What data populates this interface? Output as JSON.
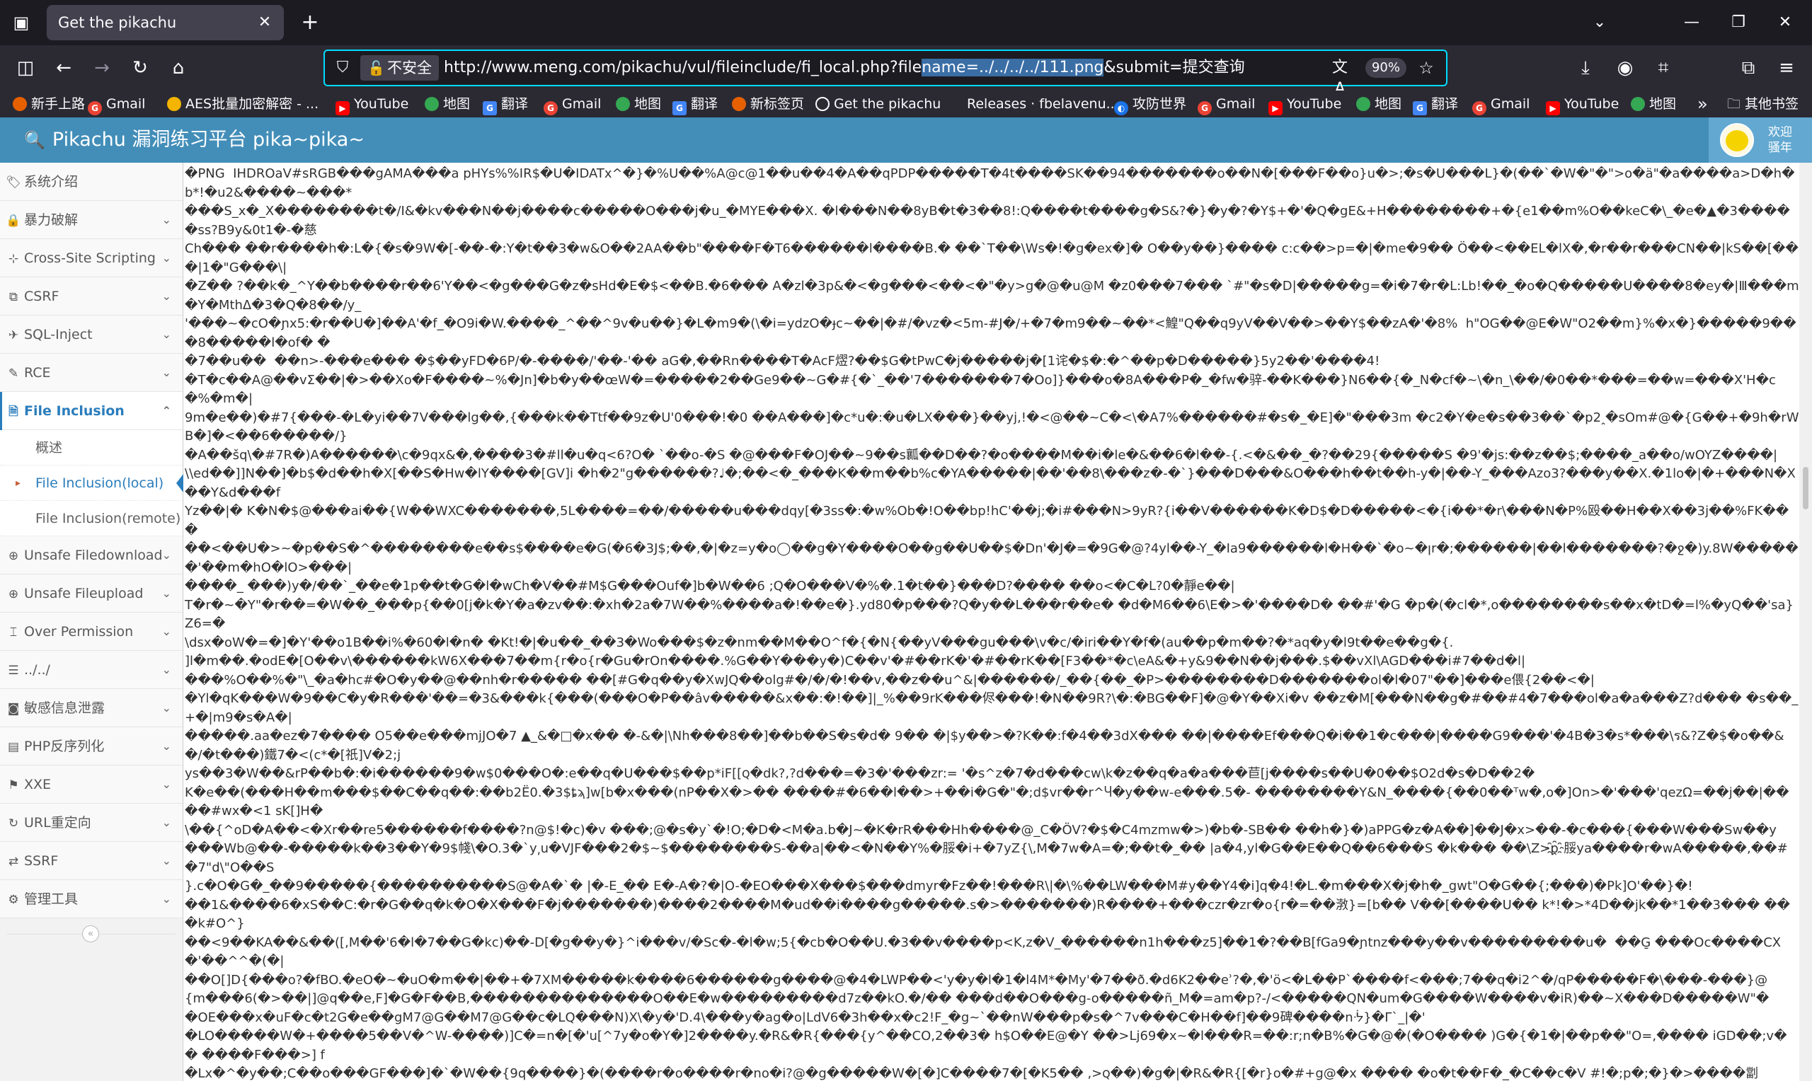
{
  "browser": {
    "tab_title": "Get the pikachu",
    "url_prefix": "http://www.meng.com/pikachu/vul/fileinclude/fi_local.php?file",
    "url_selected": "name=../../../../111.png",
    "url_suffix": "&submit=提交查询",
    "security_label": "不安全",
    "zoom": "90%",
    "icons": {
      "tab_overview": "tab-overview-icon",
      "close": "close-icon",
      "new_tab": "plus-icon",
      "back": "back-arrow-icon",
      "forward": "forward-arrow-icon",
      "reload": "reload-icon",
      "home": "home-icon",
      "sidebar_toggle": "sidebar-toggle-icon",
      "shield": "shield-icon",
      "lock": "insecure-lock-icon",
      "translate": "translate-icon",
      "star": "star-icon",
      "download": "download-icon",
      "account": "account-icon",
      "extensions": "extensions-icon",
      "menu": "hamburger-menu-icon"
    }
  },
  "bookmarks": [
    {
      "label": "新手上路",
      "color": "#e66000"
    },
    {
      "label": "Gmail",
      "color": "#ea4335"
    },
    {
      "label": "AES批量加密解密 - ...",
      "color": "#f4b400"
    },
    {
      "label": "YouTube",
      "color": "#ff0000"
    },
    {
      "label": "地图",
      "color": "#34a853"
    },
    {
      "label": "翻译",
      "color": "#4285f4"
    },
    {
      "label": "Gmail",
      "color": "#ea4335"
    },
    {
      "label": "地图",
      "color": "#34a853"
    },
    {
      "label": "翻译",
      "color": "#4285f4"
    },
    {
      "label": "新标签页",
      "color": "#e66000"
    },
    {
      "label": "Get the pikachu",
      "color": "#8f8f9d"
    },
    {
      "label": "Releases · fbelavenu...",
      "color": "#2b2a33"
    },
    {
      "label": "攻防世界",
      "color": "#1a73e8"
    },
    {
      "label": "Gmail",
      "color": "#ea4335"
    },
    {
      "label": "YouTube",
      "color": "#ff0000"
    },
    {
      "label": "地图",
      "color": "#34a853"
    },
    {
      "label": "翻译",
      "color": "#4285f4"
    },
    {
      "label": "Gmail",
      "color": "#ea4335"
    },
    {
      "label": "YouTube",
      "color": "#ff0000"
    },
    {
      "label": "地图",
      "color": "#34a853"
    }
  ],
  "bookmarks_more": "»",
  "bookmarks_other": "其他书签",
  "header": {
    "title": "Pikachu 漏洞练习平台 pika~pika~",
    "welcome_line1": "欢迎",
    "welcome_line2": "骚年",
    "accent": "#438eb9"
  },
  "sidebar": {
    "items": [
      {
        "label": "系统介绍",
        "icon": "tag-icon",
        "chevron": false
      },
      {
        "label": "暴力破解",
        "icon": "lock-icon",
        "chevron": true
      },
      {
        "label": "Cross-Site Scripting",
        "icon": "sitemap-icon",
        "chevron": true
      },
      {
        "label": "CSRF",
        "icon": "tags-icon",
        "chevron": true
      },
      {
        "label": "SQL-Inject",
        "icon": "fighter-icon",
        "chevron": true
      },
      {
        "label": "RCE",
        "icon": "pencil-icon",
        "chevron": true
      },
      {
        "label": "File Inclusion",
        "icon": "file-icon",
        "chevron": true
      },
      {
        "label": "Unsafe Filedownload",
        "icon": "download-circle-icon",
        "chevron": true
      },
      {
        "label": "Unsafe Fileupload",
        "icon": "upload-circle-icon",
        "chevron": true
      },
      {
        "label": "Over Permission",
        "icon": "text-cursor-icon",
        "chevron": true
      },
      {
        "label": "../../",
        "icon": "list-icon",
        "chevron": true
      },
      {
        "label": "敏感信息泄露",
        "icon": "camera-icon",
        "chevron": true
      },
      {
        "label": "PHP反序列化",
        "icon": "bug-icon",
        "chevron": true
      },
      {
        "label": "XXE",
        "icon": "flag-icon",
        "chevron": true
      },
      {
        "label": "URL重定向",
        "icon": "refresh-icon",
        "chevron": true
      },
      {
        "label": "SSRF",
        "icon": "exchange-icon",
        "chevron": true
      },
      {
        "label": "管理工具",
        "icon": "gear-icon",
        "chevron": true
      }
    ],
    "sub_items": [
      {
        "label": "概述"
      },
      {
        "label": "File Inclusion(local)"
      },
      {
        "label": "File Inclusion(remote)"
      }
    ]
  },
  "main": {
    "raw_output": "�PNG  IHDROaV#sRGB���gAMA���a pHYs%%IR$�U�IDATx^�}�%U��%A@c@1��u��4�A��qPDP�����T�4t����SK��94�������o��N�[���F��o}u�>;�s�U���L}�(��`�W�\"�\">o�ä\"�a����a>D�h�b*!�u2&����~���*\n���S_x�_X��������t�/I&�kv���N��j����c�����O���j�u_�MYE���X. �l���N��8yB�t�3��8!:Q����t����g�S&?�}�y�?�Y$+�'�Q�gE&+H��������+�{e1��m%O��keC�\\_�e�▲�3�����ss?B9y&0t1�-�慈\nCh��� ��r����h�:L�{�s�9W�[-��-�:Y�t��3�w&O��2AA��b\"����F�T6������l����B.� ��`T��\\Ws�!�g�ex�]� O��y��}���� c:c��>p=�|�me�9�� Ö��<��EL�lX�,�r��r���CN��|kS��[���|1�\"G���\\|\n�Z�� ?��k�_^Y��b����r��6'Y��<�g���G�z�sHd�E�$<��B.�6��� A�zl�3p&�<�g���<��<�\"�y>g�@�u@M �z0���7��� `#\"�s�D|�����g=�i�7�r�L:Lb!��_�o�Q�����U����8�ey�|Ⅲ���m�Y�MthΔ�3�Q�8��/y_\n'���~�cO�ɲx5:�r��U�]��A'�f_�O9i�W.����_^��^9v�u��}�L�m9�(\\�i=ydzO�ɟc~��|�#/�vz�<5m-#J�/+�7�m9��~��*<鰉\"Q��q9yV��V��>��Y$��zA�'�8%  h\"OG��@E�W\"O2��m}%�x�}�����9���8�����l�of� �\n�7��u��  ��n>-���e��� �$��yFD�6P/�-����/'��-'�� aG�,��Rn����T�AcF熤?��$G�tPwC�j�����j�[1诧�$�:�^��p�D�����}5y2��'����4!\n�T�c��A@��vΣ��|�>��Xo�F����~%�Jn]�b�y��œW�=�����2��Ge9��~G�#{�`_��'7�������7�Oo]}���o�8A���P�_�fw�骍-��K���}N6��{�_N�cf�~\\�n_\\��/�0��*���=��w=���X'H�c�%�m�|\n9m�e��)�#7{���-�L�yi��7V���lg��,{���k��Ttf��9z�U'0���!�0 ��A���]�c*u�:�u�LX���}��yj,!�<@��~C�<\\�A7%������#�s�_�E]�\"���3m �c2�Y�e�s��3��`�p2ꞈ�sOm#@�{G��+�9h�rWB�]�<��6�����/}\n�A��šq\\�#7R�)A������\\c�9qx&�,����3�#ll�u�q<6?O� `��o-�S �@���F�OJ��~9��s瓤��D��?�o����M��i�le�&��6�l��-{.<�&��_�?��29{�����S �9'�js:��z��$;����_a��o/wOYZ����|\n\\\\ed��]]N��]�b$�d��h�X[��S�Hw�lY����[GV]i �h�2\"g������?♩�;��<�_���K��m��b%c�YA�����|��'��8\\���z�-�`}���D���&O���h��t��h-y�|��-Y_���Azo3?���y��X.�1lo�|�+���N�X ��Y&d���f\nYz��|� K�N�$@���ai��{W��WXC�������,5L����=��/�����u���dqy[�3ss�:�w%Ob�!O��bp!hC'��j;�i#���N>9yR?{i��V������K�D$�D�����<�{i��*�r\\���N�P%殴��H��X��3j��%FK���\n��<��U�>~�p��S�^��������e��s$����e�G(�6�3J$;��,�|�z=y�o◯��g�Y����O��g��U��$�Dn'�J�=�9G�@?4yl��-Y_�Ia9������l�H��`�o~�ןr�;������|��l�������?�ջ�)y.8W������'��m�hO�lO>���|\n����_ ���)y�/��`_��e�1p��t�G�l�wCh�V��#M$G���Ouf�]b�W��6 ;Q�O���V�%�.1�t��}���D?���� ��o<�C�L?0�靜e��|\nT�r�~�Y\"�r��=�W��_���p{��0[j�k�Y�a�zv��:�xh�2a�7W��%����a�!��e�}.yd80�p���?Q�y��L���r��e� �d�M6��6\\E�>�'����D� ��#'�G �p�(�cl�*,o��������s��x�tD�=l%�yQ��'sa}Z6=�\n\\dsx�oW�=�]�Y'��o1B��i%�60�l�n� �Kt!�|�u��_��3�Wo���$�z�nm��M��O^f�{�N{��yV���gu���\\v�c/�iri��Y�f�(au��p�m��?�*aq�y�l9t��e��g�{.\n]l�m��.�odE�[O��v\\������kW6X���7��m{r�o{r�Gu�rOn����.%G��Y���y�)C��v'�#��rK�'�#��rK��[F3��*�c\\eA&�+y&9��N��j���.$��vXl\\AGD���i#7��d�l|\n���%O��%�\"\\_�a�hc#�O�y��@��nh�r����� ��[#G�q��y�XwJQ��olg#�/�/�!��v,��z��u^&|������/_��{��_�P>��������D�������ol�l�07\"��]���e偎{2��<�|\n�Yl�qK���W�9��C�y�R���'��=�3&���k{���(���O�P��âv�����&x��:�!��]|_%��9rK���侭���!�N��9R?\\�:�BG��F]�@�Y��Xi�v ��z�M[���N��g�#��#4�7���ol�a�a���Z?d��� �s��_+�|m9�s�A�|\n�����.aa�ez�7���� O5��e���mjJO�7 ▲_&�□�x�� �-&�|\\Nh���8��]��b��S�s�d� 9�� �|$y��>�?K��:f�4��3dX��� ��|����Ef���Q�i��1�c���|����G9���'�4B�3�s*���\\ร&?Z�$�o��&�/�t���)鐵7�<(c*�[祇]V�2;j\nys��3�W��&rP��b�:�i������9�w$0���O�:e��q�U���$��p*iF[[ꞯ�dk?,?d���=�3�'���zr:= '�s^z�7�d���cw\\k�z��q�a�a���苣[j����s��U�0��$O2d�s�D��2�\nK�e��(���H��m���$��C��q��:��b2Ë0.�3$ȶϡ]w[b�x���(nP��X�>�� ����#�6��l��>+��i�G�\"�;d$vr��r^Ⴗ�y��w-e���.5�- ��������Y&N_����{��0��ᵀw�,o�]On>�'���'qezΩ=��j��|����#wx�<1 sK[]H�\n\\��{^oD�A��<�Xr��re5������f����?n@$!�c)�v ���;@�s�y`�!O;�D�<M�a.b�J~�K�rR���Hh����@_C�ÖV?�$�C4mzmw�>)�b�-SB�� ��h�}�)aPPG�z�A��]��J�x>��-�c���{���W���Sw��y\n���Wb@��-�����k��3��Y�9$帴\\�O.3�`y͵u�VJF���2�$~$��������S-��a|��<�N��Y%�脮�i+�7yZ{\\,M�7w�A=�;��t�_�� |a�4,yl�G��E��Q��6���S �k��� ��\\Z>p҈脮ya����r�wA�����,��#�7\"d\\\"O��S\n}.c�O�G�_��9�����{����������S@�A�`� |�-E_�� E�-A�?�|O-�EO���X���$���dmyr�Fz��!���R\\|�\\%��LW���M#y��Y4�i]q�4!�L.�m���X�j�h�_gwt\"O�G��{;���)�Pk]O'��}�!\n��1&����6�xS��C:�r�G��q�k�O�X���F�j�������)����2����M�ud��i����g�����.s�>�������)R����+���czr�zr�o{r�=��㴾}=[b�� V��[����U�� k*!�>*4D��jk��*1��3��� ���k#O^}\n��<9��KA��&��([,M��'6�l�7��G�kc)��-D[�g��y�}^i���v/�Sc�-�l�w;5{�cb�O��U.�3��v����p<K,z�V_������n1h���z5]��1�?��B[fGa9�ɲtnz���y��v���������u�  ��G̱ ���Oc����CX�'��^^�(�|\n��O[]D{���o?�fBO.�eO�~�uO�m��|��+�7XM�����k����6������g����@�4�LWP��<'y�y�l�1�l4M*�My'�7��ð.�d6K2��eʾ?�,�'ö<�L��P`����f<���;7��q�i2^�/qP�����F�\\���-���}@\n{m���6(�>��|]@q��e,F]�G�F��B,��������������O��E�w���������d7z��kO.�/�� ���d��O���g-o�����ñ_M�=am�p?-/<�����QN�um�G����W����v�iR)��~X���D�����W\"�\n�OE���x�uF�c�t2G�e��gM7@G��M7@G��c�LQ���N)X\\�y�'D.4\\���y�ag�o|LdV6�3h��x�c2!F_�g~`��nW���p�s�^7v���C�H��f]��9碑����nᔻ}�Γ`_|�'\n�LO�����W�+����5��V�^W-����)]C�=n�[�'u[^7y�o�Y�]2����y.�R&�R{���{y^��CO,2��3� h$O��E@�Y ��>Lj69�x~�l���R=��:r;n�B%�G�@�(�O���� )G�{�1�|��p��\"O=,���� iGD��;v�� ����F���>] f\n�Lx�^�y��;C��o���GF���]�`�W��{9q����}�(����r�o����r�no�i?@�g�����W�[�]C����7�[�K5�� ,>ꞯ��)�g�|�R&�R{[�r}o�#+g@�x ���� �o�t��F�_�C��c�V #!�;p�;�}�>����劏\n��:b.�+���1�a:r;^��@�[vl�yO[9;�:�u���lH9�7��l\"sGAD]������A.��`�G��}|)�?0cx=��� h�[����/\\:CXWCXcOO^E�8e5y���㹟\"&���O���.��%-�%��<��䍰��i<�'�'�����|��X.�r�6>'�'|��82����@9��z��V�0�&%R}\n���@�>���PB�����8�f�:4�+������\"?9�E�&Ω!�⅁-M��v<&�9�▲�]6�����0���ꞯ��v�' ��B>����>:w�/���3�<�h��Ri�g�S����>��1B��yvc��ꞯ��Ó�%�)ꞯ��<�+W�ꞯ��,�c���c��&�D��ꞯ��S�\\|\n[��s�_�-<�����u. �$.<�a���/�z���IB�����ôB�/B� �H�~L�(��m�~�\\������v+�,�N�� ��0aF��GY�5+�%�|��>���M��/0HD�i;9(�T�S7 :���%L�l�@�&i�ǹd�:{k���]ꞯ�y#�8Y$� �3�N��O$�2����{�<'�<��-\n����|H6�-��D��T��� ;�J�%�G�o�z'�=h��[wn�~��Oj<�nC�O���B[�]���������H���gE��$����| i-釧��������-�jC�g~�>����b�y����y�<���_�\"B[��D�/���G9b���zs���O't�tU!\n N�5��3�F#�`��H�`D��49$��`'�禂U�6��>Hy���3���M}O�K�1��P]vV�+����>�S�y��t����+�_������� ���������$�&]��\\��q!\n���l��C��M��������n��8sS�a�1�{��PV�a9��.��n�./a�u��G���f{O�O�O�m��=��NX�9i�����+��F�J?�;y�u�<��zz5)z*W���i};a;��u&O\"L[�i}j;cE�H��U��v*}��}o\"N�A����E9�P 4�Cu��b~$�*~��|\nWmΩ'al�v�tj�:��v\\�\\rR#O^o�� 8�;����$�(�Oq�+y-�O�U_-�q6�'`D�Y����)@Jg qN8��E��淘\\p(-wÔ�9G9�Q�<=-�2�$◘DZ< W�*�H�7�?z+�KD�Eg*yV`����S����#O\"&�ekw[�e�^�o�����i+z��^\\\n���`��;m:=�^�y���CN�Y'N�tE\\w���#�C�-��O�ln���\"FB��Q�J�y/�E�z���n+�4@�h ��$K}���a���cl�D�9��YE� �q��4��3�<��h��2Ꞟ|N�\\2!�dmn+�D�w��-��\"��d��<*r���/号>��2� h%^2ã�k麗^G��t\n]���z���Z�c�?)@|�O5%��FV�O����O$���+������[qEZ9p+?;� y�t�� ���/���R_��9��d�oV��ꞯ�lll��?�8��7��7 y����uGl'�\"����8�s7�,n�d_d�D��N������ ��\n�:�9FM��n��\\�}@<���s\"���Lm$���!���$z�>��olo�T����:�*������'�gJ��@[��P8�;��H��{MQ8�X��������p?n�����A:K�s5yN��w~�[50N���=�-�yZ=�d�ꞯ<�/��Oꞯ\"OQ!\n�G�Y+y��6��M�yV��u�$�r����c�u ;�Y�E�+Q�j�K�- n�.2_g]G� mM�Y-&��\\b�K\\ �wm\\�\\���H�C�C�38x��|q�_�P����:��s�n�GM��'d&O\\�{jN�kB�O��m>`?��\\bN�� [�2n\"|1#O���f0�Z�9�:�?��,�QO�|\nl�;mc=�,�d�>[[EM��'gY&<��Tl���<�B:Sd~[��!65�$lo�.zwZ;�2�$9����O�Q�<��fw��6��#�Z�g��x��6G����AG\\t�g-$�s�os�����o2pl@~`�Z�il(�:,s���:�y���O���q�pwa �k\\�Cc� ��T�2��U�W�n�k.j��/�������m.}\nc��ger=�����@��<��a�\\n�CF�l��W��{i\"�@棄� ��5k�2�l??;�����d �$Q�8�22��A�q%���_�d���_[��)o:FB�g�o;x-�t�-��Ha���pF�s���;p�>u\"��`�O����M]����V �d��p��_����m*��+;A�e�Ô�ꞯ��ijE&t]J}9�\n\\�:A�w7|TP{��W[?c�2�4�/!1 �9g?u��!Z�@:C��{#��|����DbX�#&O� E��C��H�g\"P�-z6�<�9�|+�i;1�W �.�$6�������+Hx ���F�����D�E�P�a>D}gyB>��}�� C�v:���p�w�u�y�q[��>}�9�9�^���erW5����v�Y#O����o�l��b|A]:=ak���ꞯ\nc�Ꞟ%0g'�s�sG'�_~8g�>�~�C#LO�!<@�@����@Q����j������J[D�[���Q`����E�3�!Y�'yR�O�O���1�E��S��V�e |H���G �bG�\\O�DbX�������}�s�&�=~�-al�����3�8@�=���Q����8�L���Rq>@d<\n�m�&{!@��a8���4 �W���w}�Oq�em�l�tn����+_Gt�{ ���Uf~<} x�9vJ9�0��j�'\"���.! �~@s���#T �% z._{�Z/$����cs!�P>�+�.`MO&�~������@^m�~/Ꞟ�X~@d� ��Er�hm /G=�������$D��>yrORw���1jpN��  a�#��R@�O��y� ���Z�Qg\nTO���N=�ꞯ�BB���8d�G�&�1�r�W����t�|��]Q:�������n7��%����hd������|w�?8�@]7 |��:�oǾZ����z��N8��-s_pl@s�v+P��Q71(y�. �B����g��L�u�u8q*G?�$'<9nho[]�qJ9�9��?��F���1�8O�U/�3.�IT^�?�+7�+�������\n�#bG\"�-�!@�P ���@O����Z��  |O��#��O-E�aʾ^O�Q*�y.�[���@ZO��-F�|��n�a@aa��@ �.�v������r@����#/��/VOL����i@ �X���d ����� �XO�/ff����� �P-1 ;@x��5��P������x����:1�>-\\b�o�.<$#  ~�ꞯ�iO�|"
  }
}
